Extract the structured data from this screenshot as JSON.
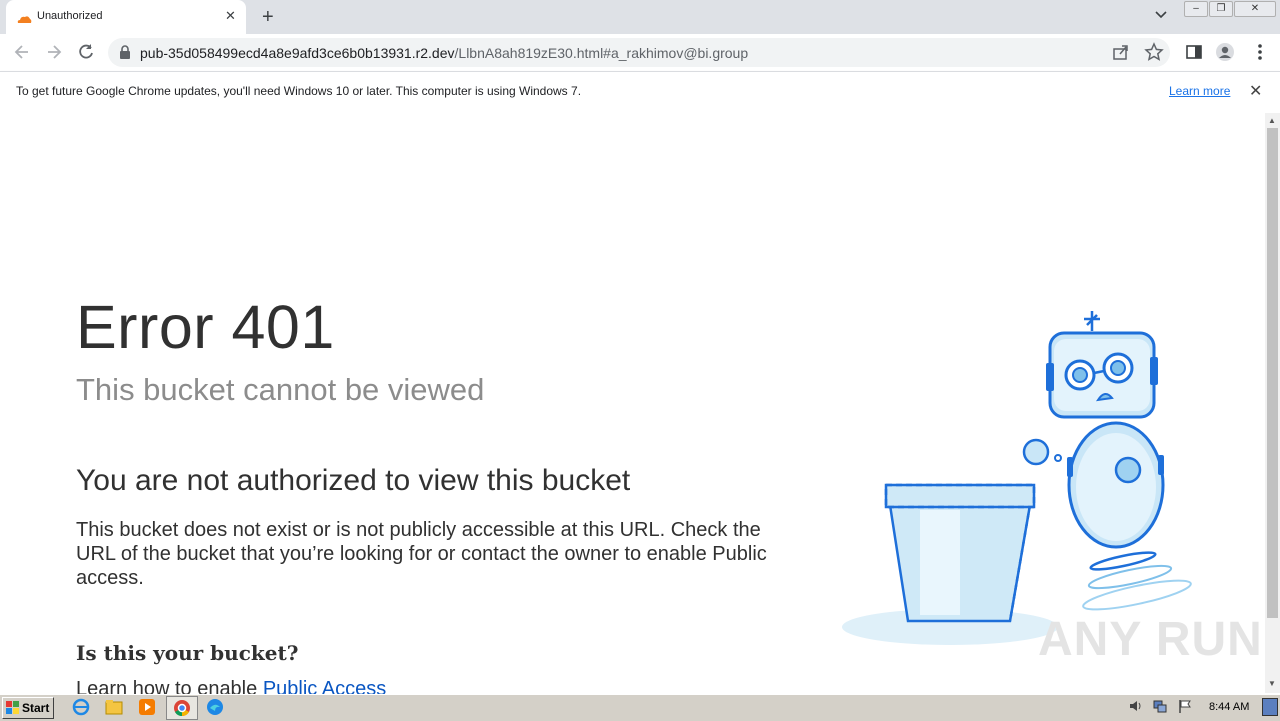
{
  "browser": {
    "tab_title": "Unauthorized",
    "tab_close": "✕",
    "new_tab": "+",
    "url_host": "pub-35d058499ecd4a8e9afd3ce6b0b13931.r2.dev",
    "url_path": "/LlbnA8ah819zE30.html#a_rakhimov@bi.group"
  },
  "infobar": {
    "message": "To get future Google Chrome updates, you'll need Windows 10 or later. This computer is using Windows 7.",
    "learn_more": "Learn more",
    "close": "✕"
  },
  "page": {
    "error_title": "Error 401",
    "error_subtitle": "This bucket cannot be viewed",
    "heading": "You are not authorized to view this bucket",
    "body": "This bucket does not exist or is not publicly accessible at this URL. Check the URL of the bucket that you’re looking for or contact the owner to enable Public access.",
    "question": "Is this your bucket?",
    "learn_prefix": "Learn how to enable ",
    "learn_link": "Public Access"
  },
  "watermark": "ANY RUN",
  "taskbar": {
    "start_label": "Start",
    "clock": "8:44 AM"
  },
  "colors": {
    "tabstrip": "#dee1e6",
    "link": "#1a73e8",
    "robot_blue": "#1e6fd9",
    "robot_fill": "#c9e6f7"
  }
}
